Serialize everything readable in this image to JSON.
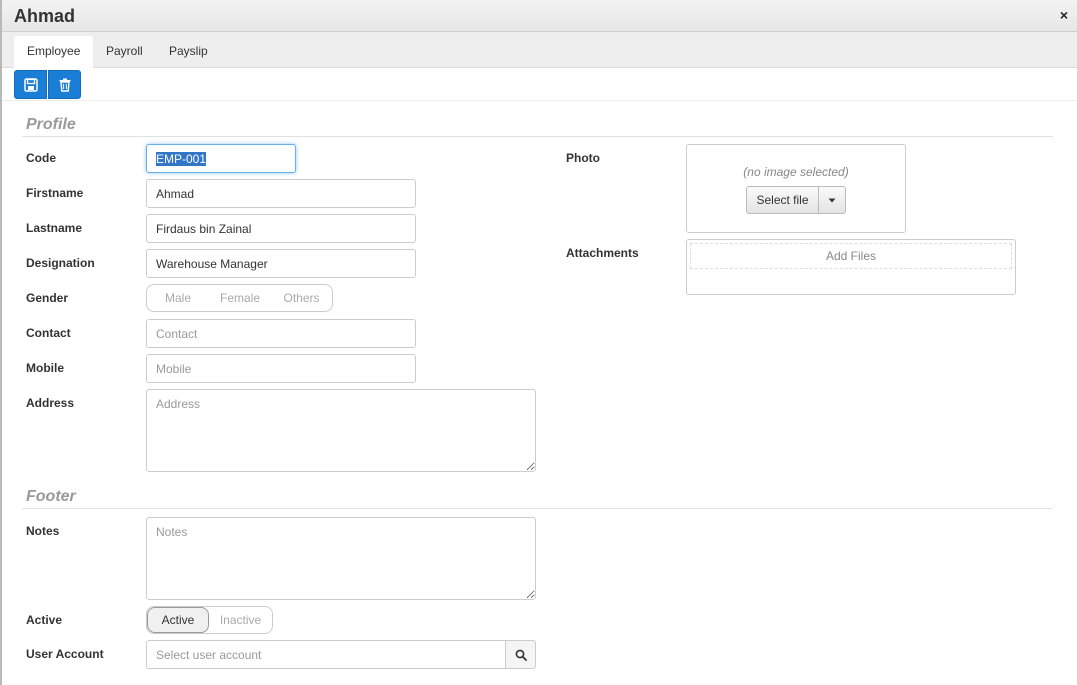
{
  "window": {
    "title": "Ahmad",
    "close_glyph": "×"
  },
  "tabs": [
    {
      "label": "Employee",
      "active": true
    },
    {
      "label": "Payroll",
      "active": false
    },
    {
      "label": "Payslip",
      "active": false
    }
  ],
  "toolbar": {
    "save_icon": "floppy-disk-icon",
    "delete_icon": "trash-icon",
    "accent_color": "#1a7dd6"
  },
  "profile": {
    "section_title": "Profile",
    "code": {
      "label": "Code",
      "value": "EMP-001"
    },
    "firstname": {
      "label": "Firstname",
      "value": "Ahmad"
    },
    "lastname": {
      "label": "Lastname",
      "value": "Firdaus bin Zainal"
    },
    "designation": {
      "label": "Designation",
      "value": "Warehouse Manager"
    },
    "gender": {
      "label": "Gender",
      "options": [
        "Male",
        "Female",
        "Others"
      ]
    },
    "contact": {
      "label": "Contact",
      "placeholder": "Contact",
      "value": ""
    },
    "mobile": {
      "label": "Mobile",
      "placeholder": "Mobile",
      "value": ""
    },
    "address": {
      "label": "Address",
      "placeholder": "Address",
      "value": ""
    },
    "photo": {
      "label": "Photo",
      "empty_text": "(no image selected)",
      "select_label": "Select file"
    },
    "attachments": {
      "label": "Attachments",
      "add_label": "Add Files"
    }
  },
  "footer": {
    "section_title": "Footer",
    "notes": {
      "label": "Notes",
      "placeholder": "Notes",
      "value": ""
    },
    "active": {
      "label": "Active",
      "options": [
        "Active",
        "Inactive"
      ],
      "selected": "Active"
    },
    "user_account": {
      "label": "User Account",
      "placeholder": "Select user account",
      "value": ""
    }
  }
}
